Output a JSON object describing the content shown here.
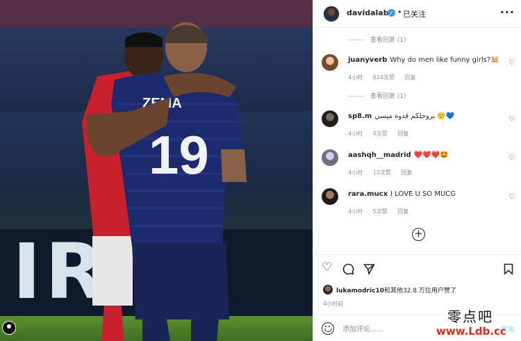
{
  "header": {
    "username": "davidalaba",
    "separator": "•",
    "follow_status": "已关注",
    "more_icon": "more-icon"
  },
  "view_replies": [
    {
      "label": "查看回复 (1)"
    },
    {
      "label": "查看回复 (1)"
    }
  ],
  "comments": [
    {
      "username": "juanyverb",
      "text": "Why do men like funny girls?🐹",
      "time": "4小时",
      "likes": "624次赞",
      "reply": "回复"
    },
    {
      "username": "sp8.m",
      "text": "بروحلكم قدوة ميسي 🙂💙",
      "time": "4小时",
      "likes": "4次赞",
      "reply": "回复"
    },
    {
      "username": "aashqh__madrid",
      "text": "❤️❤️❤️🤩",
      "time": "4小时",
      "likes": "12次赞",
      "reply": "回复"
    },
    {
      "username": "rara.mucx",
      "text": "I LOVE U SO MUCG",
      "time": "4小时",
      "likes": "5次赞",
      "reply": "回复"
    }
  ],
  "likes": {
    "user": "lukamodric10",
    "summary": "和其他32.8 万位用户赞了"
  },
  "post_time": "4小时前",
  "composer": {
    "placeholder": "添加评论......",
    "send_label": "发布"
  },
  "watermark": {
    "line1": "零点吧",
    "line2": "www.Ldb.cc"
  },
  "photo": {
    "banner_letters": "IRI"
  },
  "colors": {
    "accent": "#3897f0",
    "send_disabled": "#b2dffc",
    "muted": "#8e8e8e"
  }
}
